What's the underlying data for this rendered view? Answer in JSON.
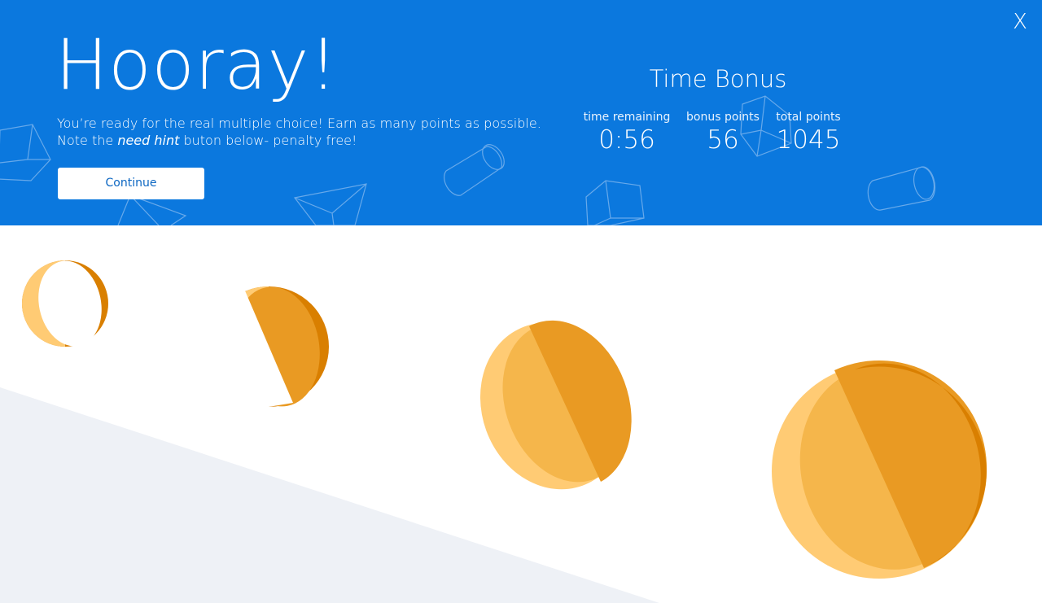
{
  "modal": {
    "close_label": "X",
    "title": "Hooray!",
    "message_part1": "You’re ready for the real multiple choice! Earn as many points as possible.",
    "message_part2_prefix": "Note the ",
    "message_emphasis": "need hint",
    "message_part2_suffix": " buton below- penalty free!",
    "continue_label": "Continue"
  },
  "time_bonus": {
    "title": "Time Bonus",
    "time_remaining_label": "time remaining",
    "time_remaining_value": "0:56",
    "bonus_points_label": "bonus points",
    "bonus_points_value": "56",
    "total_points_label": "total points",
    "total_points_value": "1045"
  },
  "colors": {
    "banner": "#0b78de",
    "coin_light": "#ffcb74",
    "coin_mid": "#f5b64b",
    "coin_dark": "#e99a23",
    "coin_edge": "#d97f00",
    "ground": "#eef1f6"
  },
  "icons": [
    "close-icon",
    "cube-icon",
    "cylinder-icon",
    "pyramid-icon",
    "coin-icon"
  ]
}
